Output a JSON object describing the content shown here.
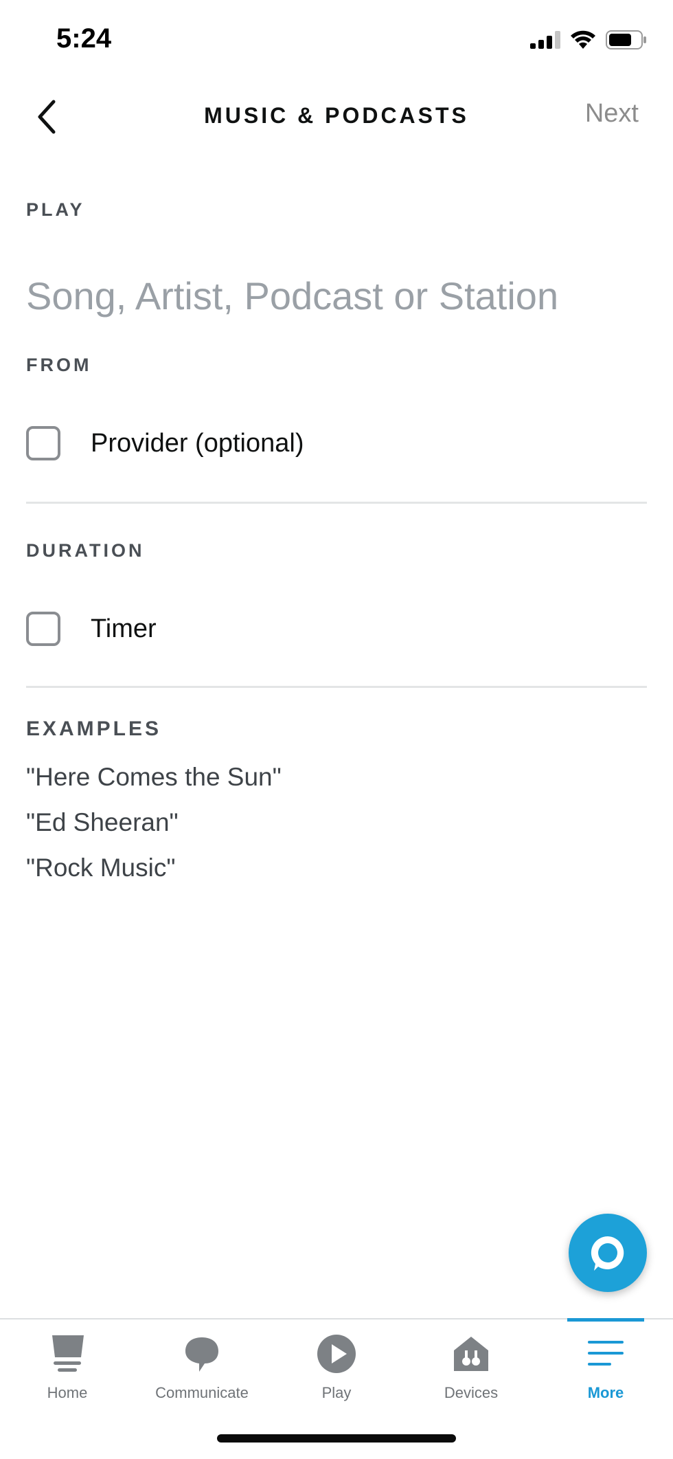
{
  "status_bar": {
    "time": "5:24",
    "icons": [
      "cellular-signal-icon",
      "wifi-icon",
      "battery-icon"
    ]
  },
  "nav": {
    "title": "MUSIC & PODCASTS",
    "next_label": "Next",
    "back_icon": "chevron-left-icon"
  },
  "play": {
    "label": "PLAY",
    "placeholder": "Song, Artist, Podcast or Station",
    "value": ""
  },
  "from": {
    "label": "FROM",
    "option_label": "Provider (optional)",
    "checked": false
  },
  "duration": {
    "label": "DURATION",
    "option_label": "Timer",
    "checked": false
  },
  "examples": {
    "label": "EXAMPLES",
    "items": [
      "\"Here Comes the Sun\"",
      "\"Ed Sheeran\"",
      "\"Rock Music\""
    ]
  },
  "alexa_button": {
    "icon": "alexa-icon"
  },
  "tabs": [
    {
      "label": "Home",
      "icon": "home-icon",
      "active": false
    },
    {
      "label": "Communicate",
      "icon": "chat-bubble-icon",
      "active": false
    },
    {
      "label": "Play",
      "icon": "play-icon",
      "active": false
    },
    {
      "label": "Devices",
      "icon": "devices-icon",
      "active": false
    },
    {
      "label": "More",
      "icon": "menu-icon",
      "active": true
    }
  ],
  "colors": {
    "accent": "#1a98d5",
    "alexa_blue": "#1da1d8",
    "placeholder": "#9aa0a6",
    "inactive_tab": "#6f7377"
  }
}
